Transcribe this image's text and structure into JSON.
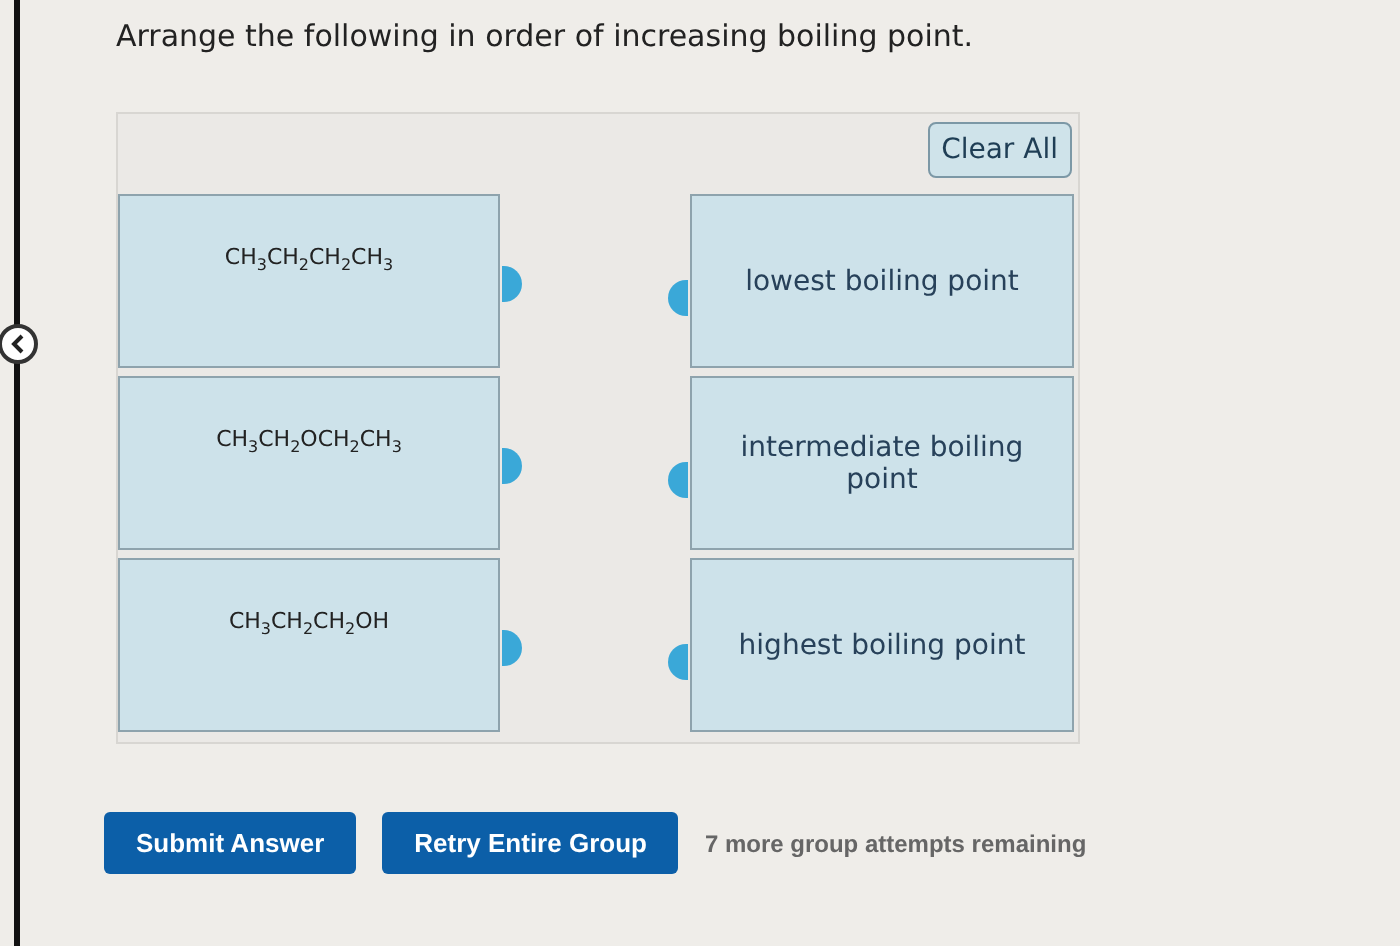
{
  "question": "Arrange the following in order of increasing boiling point.",
  "clear_button": "Clear All",
  "items": [
    {
      "formula": "CH$_{3}$CH$_{2}$CH$_{2}$CH$_{3}$"
    },
    {
      "formula": "CH$_{3}$CH$_{2}$OCH$_{2}$CH$_{3}$"
    },
    {
      "formula": "CH$_{3}$CH$_{2}$CH$_{2}$OH"
    }
  ],
  "targets": [
    {
      "label": "lowest boiling point"
    },
    {
      "label": "intermediate boiling point"
    },
    {
      "label": "highest boiling point"
    }
  ],
  "buttons": [
    "Submit Answer",
    "Retry Entire Group"
  ],
  "attempts_note": "7 more group attempts remaining"
}
